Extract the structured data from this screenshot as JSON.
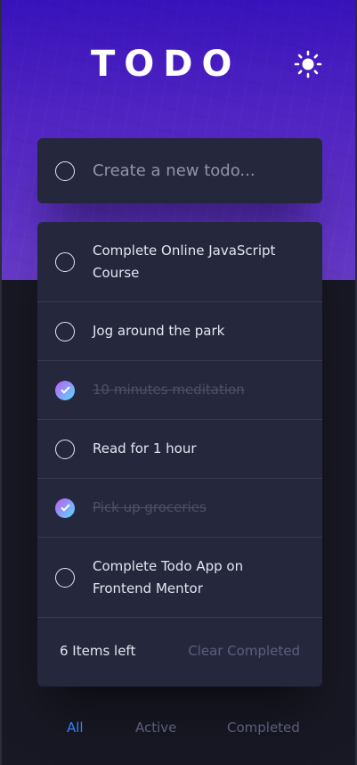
{
  "header": {
    "title": "TODO",
    "theme_icon": "sun-icon"
  },
  "new_todo": {
    "placeholder": "Create a new todo..."
  },
  "todos": [
    {
      "text": "Complete Online JavaScript Course",
      "completed": false
    },
    {
      "text": "Jog around the park",
      "completed": false
    },
    {
      "text": "10 minutes meditation",
      "completed": true
    },
    {
      "text": "Read for 1 hour",
      "completed": false
    },
    {
      "text": "Pick up groceries",
      "completed": true
    },
    {
      "text": "Complete Todo App on Frontend Mentor",
      "completed": false
    }
  ],
  "footer": {
    "items_left": "6 Items left",
    "clear_label": "Clear Completed"
  },
  "filters": {
    "all": "All",
    "active": "Active",
    "completed": "Completed",
    "selected": "All"
  },
  "colors": {
    "accent": "#3a7cfd",
    "card": "#25273d",
    "background": "#171823",
    "check_gradient_start": "#c058f3",
    "check_gradient_end": "#55ddff"
  }
}
